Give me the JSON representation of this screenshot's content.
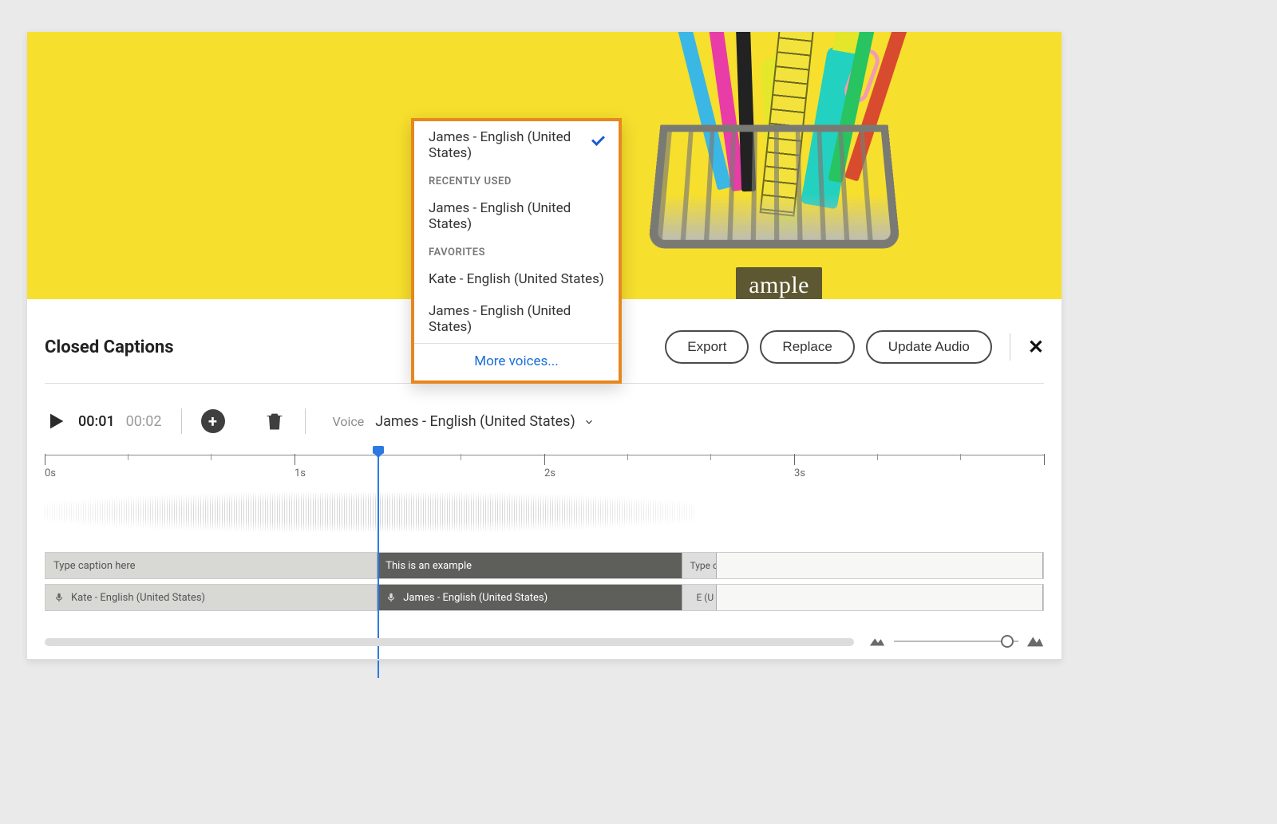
{
  "slide": {
    "caption_text": "ample"
  },
  "voice_dropdown": {
    "selected": "James - English (United States)",
    "headers": {
      "recent": "RECENTLY USED",
      "favorites": "FAVORITES"
    },
    "recent": [
      "James - English (United States)"
    ],
    "favorites": [
      "Kate - English (United States)",
      "James - English (United States)"
    ],
    "more": "More voices..."
  },
  "panel": {
    "title": "Closed Captions",
    "buttons": {
      "export": "Export",
      "replace": "Replace",
      "update": "Update Audio"
    }
  },
  "toolbar": {
    "time_current": "00:01",
    "time_total": "00:02",
    "voice_label": "Voice",
    "voice_selected": "James - English (United States)"
  },
  "timeline": {
    "ticks": [
      "0s",
      "1s",
      "2s",
      "3s"
    ]
  },
  "captions_row": {
    "clip1": "Type caption here",
    "clip2": "This is an example",
    "clip3": "Type capt..."
  },
  "voice_row": {
    "clip1": "Kate - English (United States)",
    "clip2": "James - English (United States)",
    "clip3": "E (U"
  }
}
